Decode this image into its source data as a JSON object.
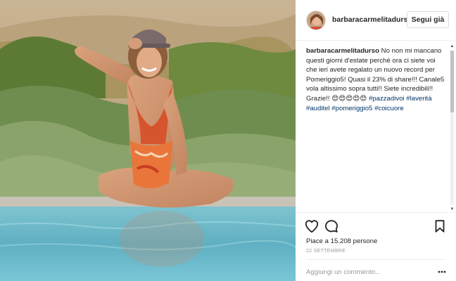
{
  "header": {
    "username": "barbaracarmelitadurso",
    "follow_label": "Segui già"
  },
  "caption": {
    "username": "barbaracarmelitadurso",
    "text": " No non mi mancano questi giorni d'estate perché ora ci siete voi che ieri avete regalato un nuovo record per Pomeriggio5! Quasi il 23% di share!!! Canale5 vola altissimo sopra tutti!! Siete incredibili!! Grazie!! 😍😍😍😍😍 ",
    "hashtags": [
      "#pazzadivoi",
      "#laverità",
      "#auditel",
      "#pomeriggio5",
      "#coicuore"
    ]
  },
  "actions": {
    "likes_text": "Piace a 15.208 persone",
    "date": "22 SETTEMBRE",
    "comment_placeholder": "Aggiungi un commento..."
  },
  "icons": {
    "like": "heart-outline-icon",
    "comment": "speech-bubble-icon",
    "save": "bookmark-icon",
    "more": "ellipsis-icon"
  },
  "colors": {
    "text": "#262626",
    "hashtag": "#003569",
    "muted": "#999999",
    "border": "#dbdbdb"
  }
}
